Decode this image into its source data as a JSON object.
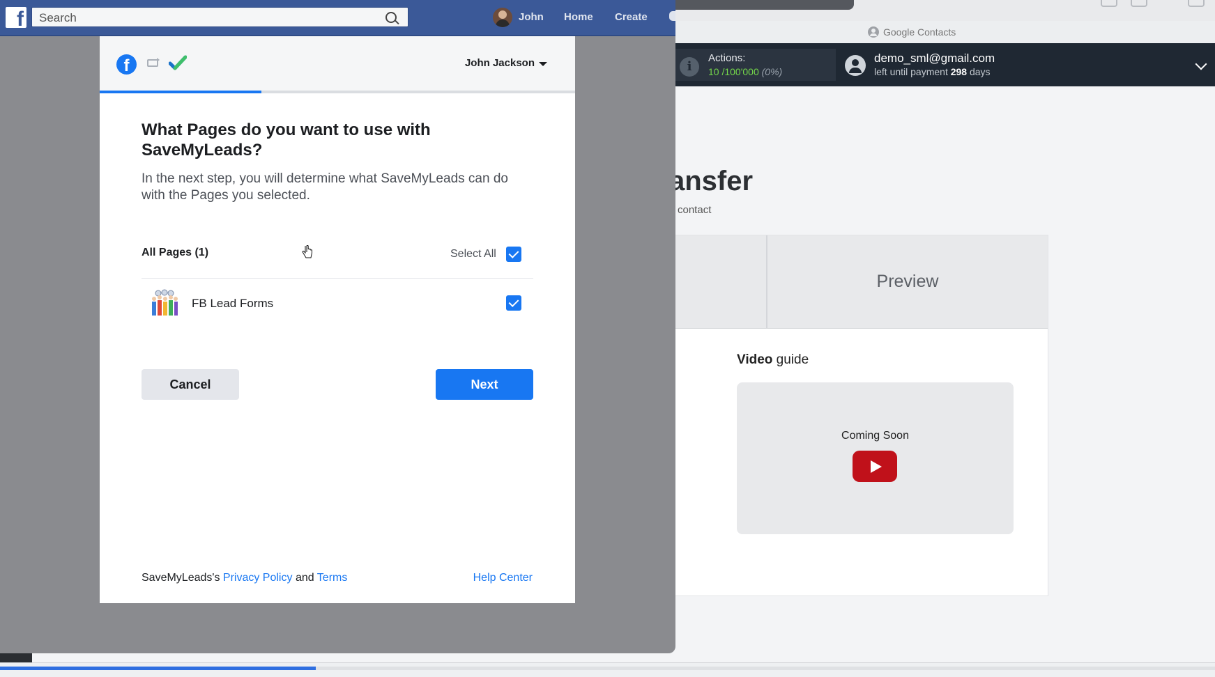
{
  "facebook": {
    "logo": "f",
    "search_placeholder": "Search",
    "nav": {
      "user": "John",
      "home": "Home",
      "create": "Create"
    }
  },
  "dialog": {
    "user_name": "John Jackson",
    "progress_fraction": 0.34,
    "title": "What Pages do you want to use with SaveMyLeads?",
    "description": "In the next step, you will determine what SaveMyLeads can do with the Pages you selected.",
    "all_pages_label": "All Pages (1)",
    "select_all_label": "Select All",
    "select_all_checked": true,
    "pages": [
      {
        "name": "FB Lead Forms",
        "checked": true
      }
    ],
    "cancel_label": "Cancel",
    "next_label": "Next",
    "footer": {
      "prefix": "SaveMyLeads's",
      "privacy": "Privacy Policy",
      "and": "and",
      "terms": "Terms",
      "help": "Help Center"
    }
  },
  "app": {
    "tab_title": "Google Contacts",
    "actions_label": "Actions:",
    "actions_used": "10",
    "actions_total": "/100'000",
    "actions_percent": "(0%)",
    "account_email": "demo_sml@gmail.com",
    "payment_prefix": "left until payment",
    "payment_days": "298",
    "payment_suffix": "days",
    "heading_partial": "ansfer",
    "subheading_partial": "contact",
    "preview_tab": "Preview",
    "video_guide_bold": "Video",
    "video_guide_rest": "guide",
    "coming_soon": "Coming Soon"
  },
  "page_load_progress_fraction": 0.26,
  "colors": {
    "fb_blue": "#1877f2",
    "fb_top": "#3b5998",
    "app_dark": "#1f2833",
    "accent_green": "#74d64a",
    "youtube_red": "#c0111a"
  }
}
